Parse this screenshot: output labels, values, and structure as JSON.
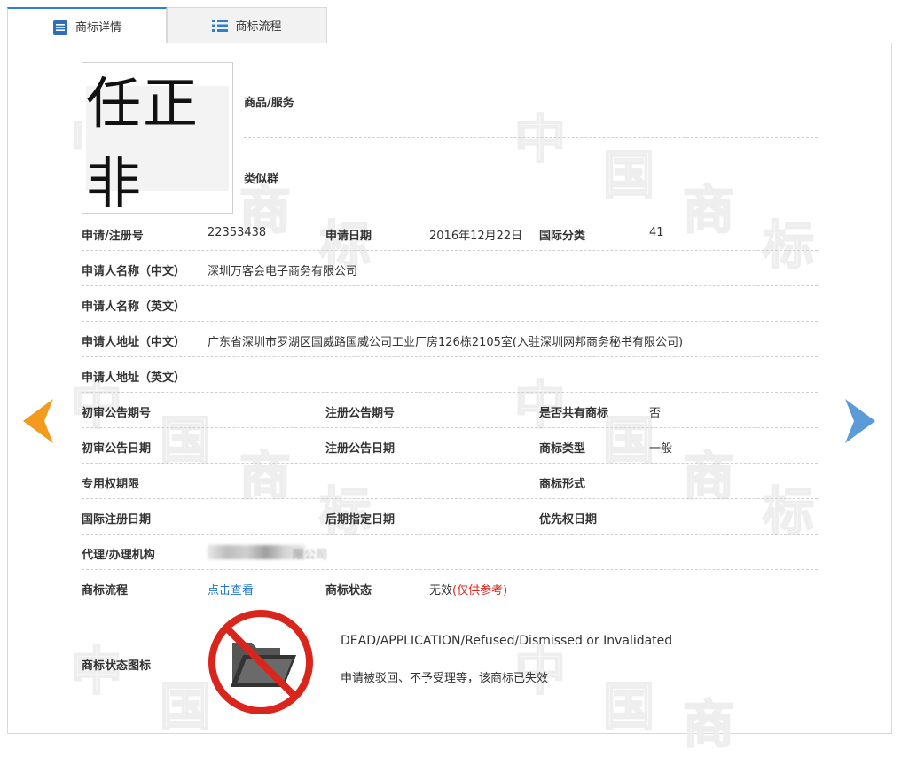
{
  "tabs": [
    {
      "label": "商标详情",
      "icon": "document-list-icon",
      "active": true
    },
    {
      "label": "商标流程",
      "icon": "grid-list-icon",
      "active": false
    }
  ],
  "logo": {
    "text": "任正非"
  },
  "top_fields": {
    "goods_label": "商品/服务",
    "similar_label": "类似群"
  },
  "rows": {
    "reg_no_label": "申请/注册号",
    "reg_no": "22353438",
    "app_date_label": "申请日期",
    "app_date": "2016年12月22日",
    "intl_class_label": "国际分类",
    "intl_class": "41",
    "applicant_cn_label": "申请人名称（中文）",
    "applicant_cn": "深圳万客会电子商务有限公司",
    "applicant_en_label": "申请人名称（英文）",
    "address_cn_label": "申请人地址（中文）",
    "address_cn": "广东省深圳市罗湖区国威路国威公司工业厂房126栋2105室(入驻深圳网邦商务秘书有限公司)",
    "address_en_label": "申请人地址（英文）",
    "prelim_no_label": "初审公告期号",
    "reg_pub_no_label": "注册公告期号",
    "shared_label": "是否共有商标",
    "shared": "否",
    "prelim_date_label": "初审公告日期",
    "reg_pub_date_label": "注册公告日期",
    "tm_type_label": "商标类型",
    "tm_type": "一般",
    "exclusive_label": "专用权期限",
    "tm_form_label": "商标形式",
    "intl_reg_date_label": "国际注册日期",
    "later_date_label": "后期指定日期",
    "priority_label": "优先权日期",
    "agent_label": "代理/办理机构",
    "agent_visible": "限公司",
    "process_label": "商标流程",
    "process_link": "点击查看",
    "status_label": "商标状态",
    "status": "无效",
    "status_note": "(仅供参考)",
    "status_icon_label": "商标状态图标",
    "status_en": "DEAD/APPLICATION/Refused/Dismissed or Invalidated",
    "status_cn": "申请被驳回、不予受理等，该商标已失效"
  },
  "watermark": [
    "中",
    "国",
    "商",
    "标"
  ],
  "colors": {
    "accent": "#2f7fd0",
    "prev_arrow": "#f39a1f",
    "next_arrow": "#5b9bd8",
    "status_red": "#d9251b",
    "link": "#2277cc"
  }
}
